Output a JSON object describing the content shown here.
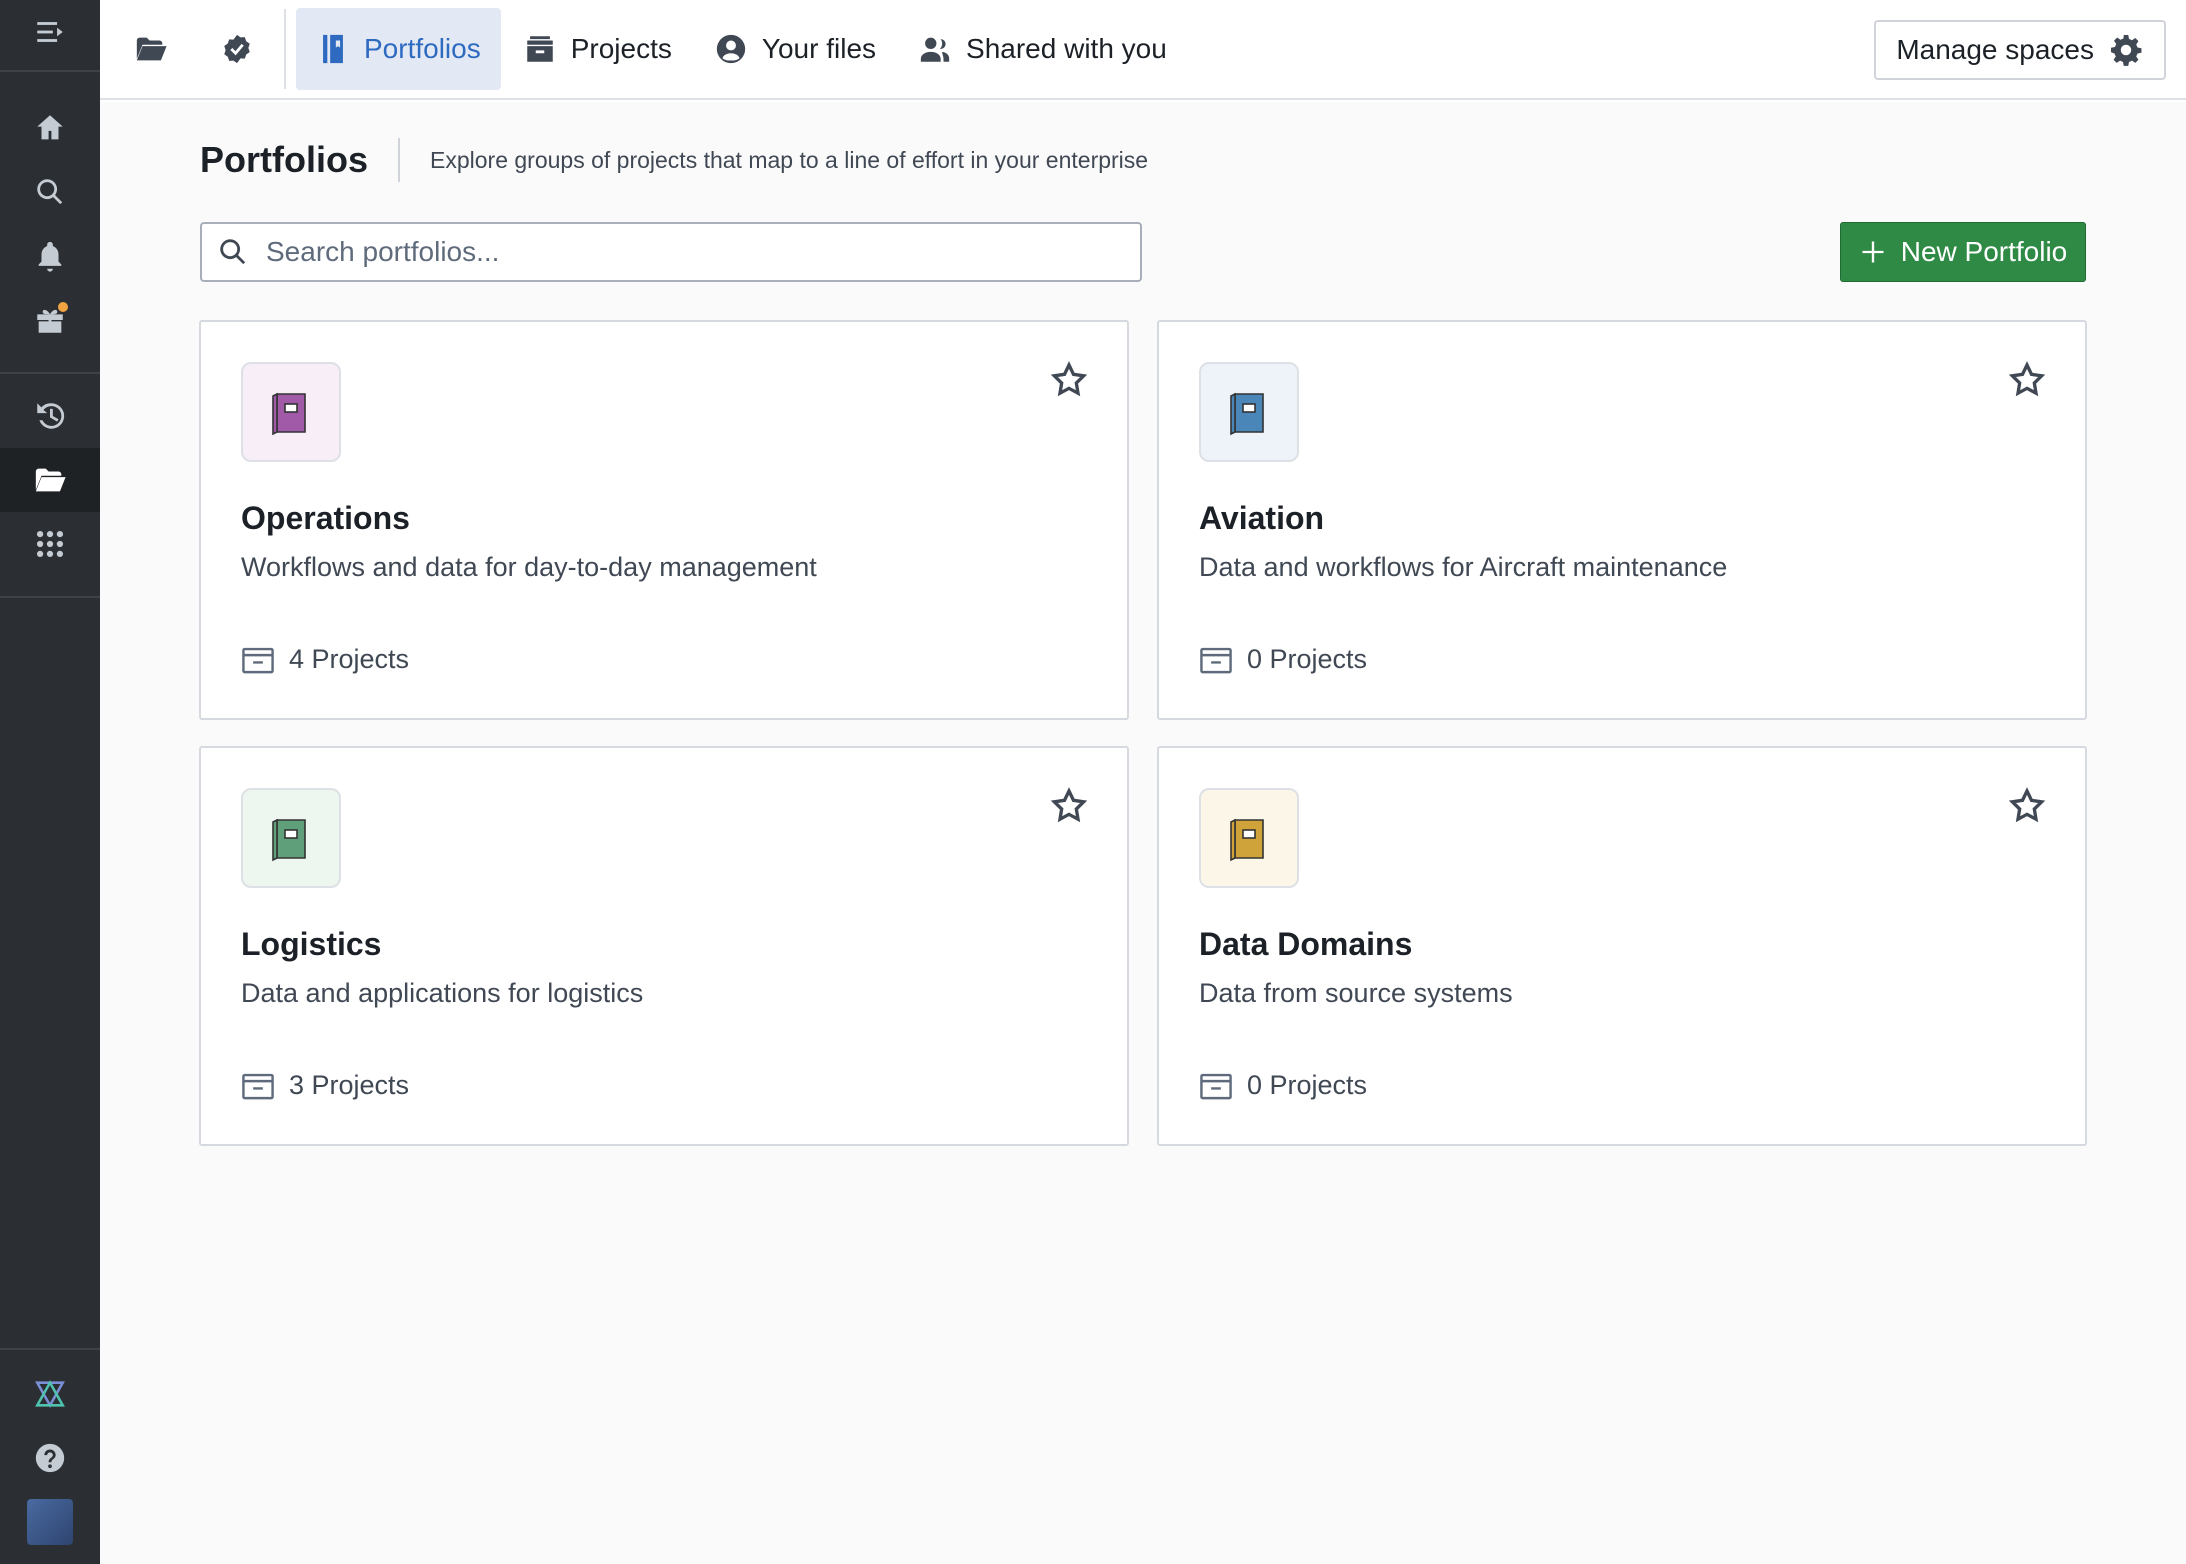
{
  "topbar": {
    "tabs": [
      {
        "label": "Portfolios",
        "icon": "portfolio-icon",
        "active": true
      },
      {
        "label": "Projects",
        "icon": "projects-icon",
        "active": false
      },
      {
        "label": "Your files",
        "icon": "user-icon",
        "active": false
      },
      {
        "label": "Shared with you",
        "icon": "people-icon",
        "active": false
      }
    ],
    "manage_label": "Manage spaces"
  },
  "page": {
    "title": "Portfolios",
    "subtitle": "Explore groups of projects that map to a line of effort in your enterprise"
  },
  "search": {
    "placeholder": "Search portfolios..."
  },
  "new_button": {
    "label": "New Portfolio"
  },
  "portfolios": [
    {
      "title": "Operations",
      "description": "Workflows and data for day-to-day management",
      "count": "4 Projects",
      "color": "#a05aa8",
      "bg": "#f7eef7"
    },
    {
      "title": "Aviation",
      "description": "Data and workflows for Aircraft maintenance",
      "count": "0 Projects",
      "color": "#4a86b8",
      "bg": "#eef3fa"
    },
    {
      "title": "Logistics",
      "description": "Data and applications for logistics",
      "count": "3 Projects",
      "color": "#5fa07a",
      "bg": "#eef6f0"
    },
    {
      "title": "Data Domains",
      "description": "Data from source systems",
      "count": "0 Projects",
      "color": "#d0a33a",
      "bg": "#fbf6e8"
    }
  ]
}
